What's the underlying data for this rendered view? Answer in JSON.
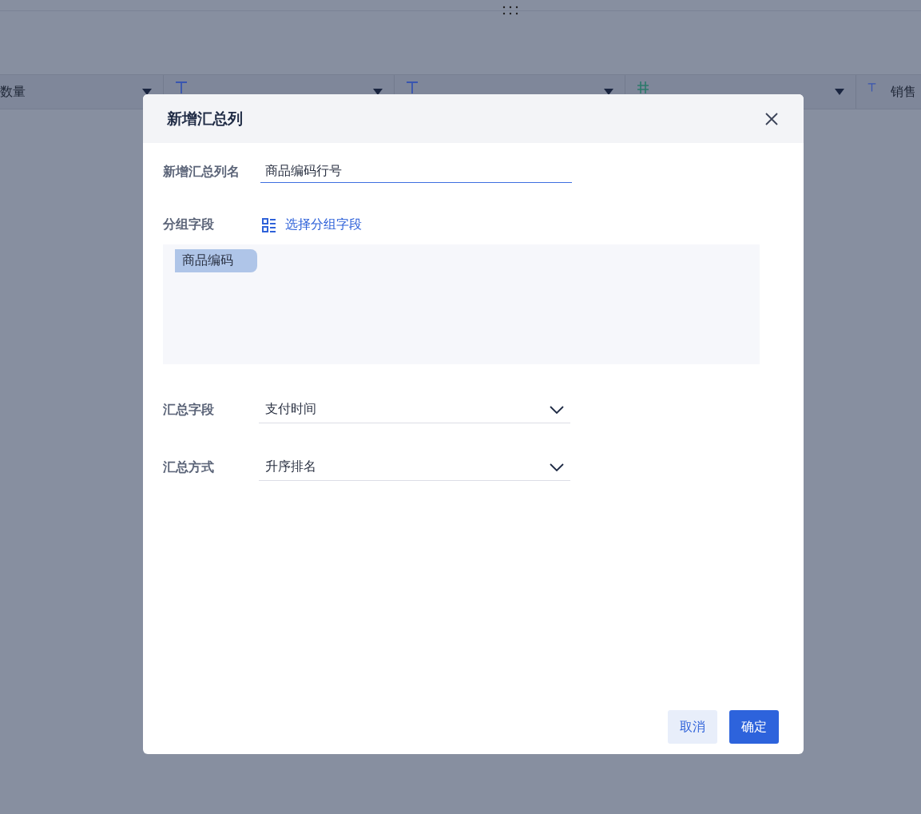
{
  "table_header": {
    "columns": [
      {
        "kind": "none",
        "label": "数量"
      },
      {
        "kind": "text"
      },
      {
        "kind": "text"
      },
      {
        "kind": "number"
      },
      {
        "kind": "text",
        "label": "销售"
      }
    ]
  },
  "dialog": {
    "title": "新增汇总列",
    "name_field": {
      "label": "新增汇总列名",
      "value": "商品编码行号"
    },
    "group_field": {
      "label": "分组字段",
      "action": "选择分组字段",
      "tags": [
        "商品编码"
      ]
    },
    "selects": [
      {
        "label": "汇总字段",
        "value": "支付时间"
      },
      {
        "label": "汇总方式",
        "value": "升序排名"
      }
    ],
    "buttons": [
      {
        "label": "取消",
        "kind": "secondary"
      },
      {
        "label": "确定",
        "kind": "primary"
      }
    ]
  }
}
